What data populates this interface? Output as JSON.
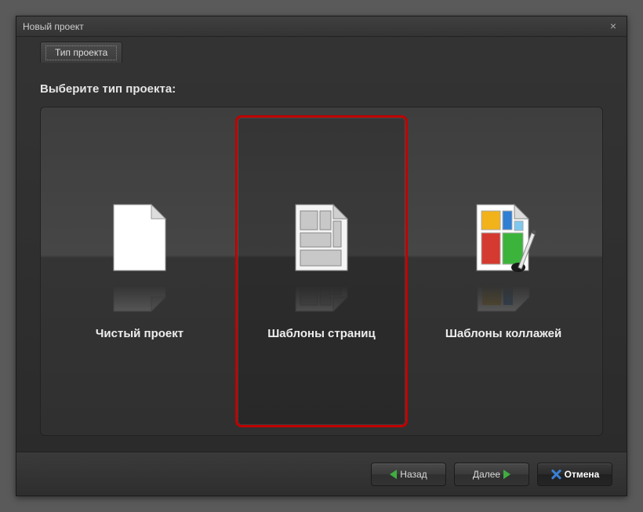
{
  "window": {
    "title": "Новый проект"
  },
  "tabs": {
    "type_tab": "Тип проекта"
  },
  "prompt": "Выберите тип проекта:",
  "options": [
    {
      "label": "Чистый проект"
    },
    {
      "label": "Шаблоны страниц"
    },
    {
      "label": "Шаблоны коллажей"
    }
  ],
  "buttons": {
    "back": "Назад",
    "next": "Далее",
    "cancel": "Отмена"
  }
}
